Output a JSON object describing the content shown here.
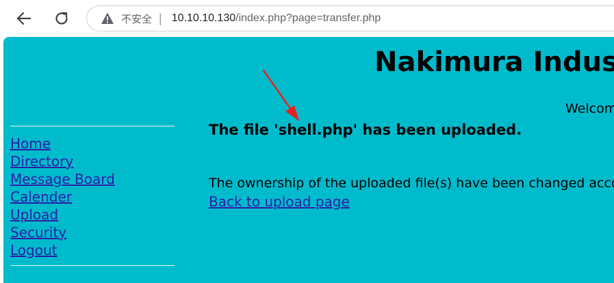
{
  "browser": {
    "insecure_label": "不安全",
    "separator": "|",
    "url_host": "10.10.10.130",
    "url_path": "/index.php?page=transfer.php",
    "icons": [
      "back-arrow-icon",
      "reload-icon",
      "warning-icon"
    ]
  },
  "site": {
    "title": "Nakimura Industr",
    "welcome": "Welcom"
  },
  "sidebar": {
    "items": [
      {
        "label": "Home"
      },
      {
        "label": "Directory"
      },
      {
        "label": "Message Board"
      },
      {
        "label": "Calender"
      },
      {
        "label": "Upload"
      },
      {
        "label": "Security"
      },
      {
        "label": "Logout"
      }
    ]
  },
  "main": {
    "upload_message": "The file 'shell.php' has been uploaded.",
    "ownership_text": "The ownership of the uploaded file(s) have been changed acco",
    "back_link": "Back to upload page"
  },
  "colors": {
    "page_background": "#00bbcc",
    "link": "#2d1fa8",
    "annotation_arrow": "#e8231f"
  }
}
